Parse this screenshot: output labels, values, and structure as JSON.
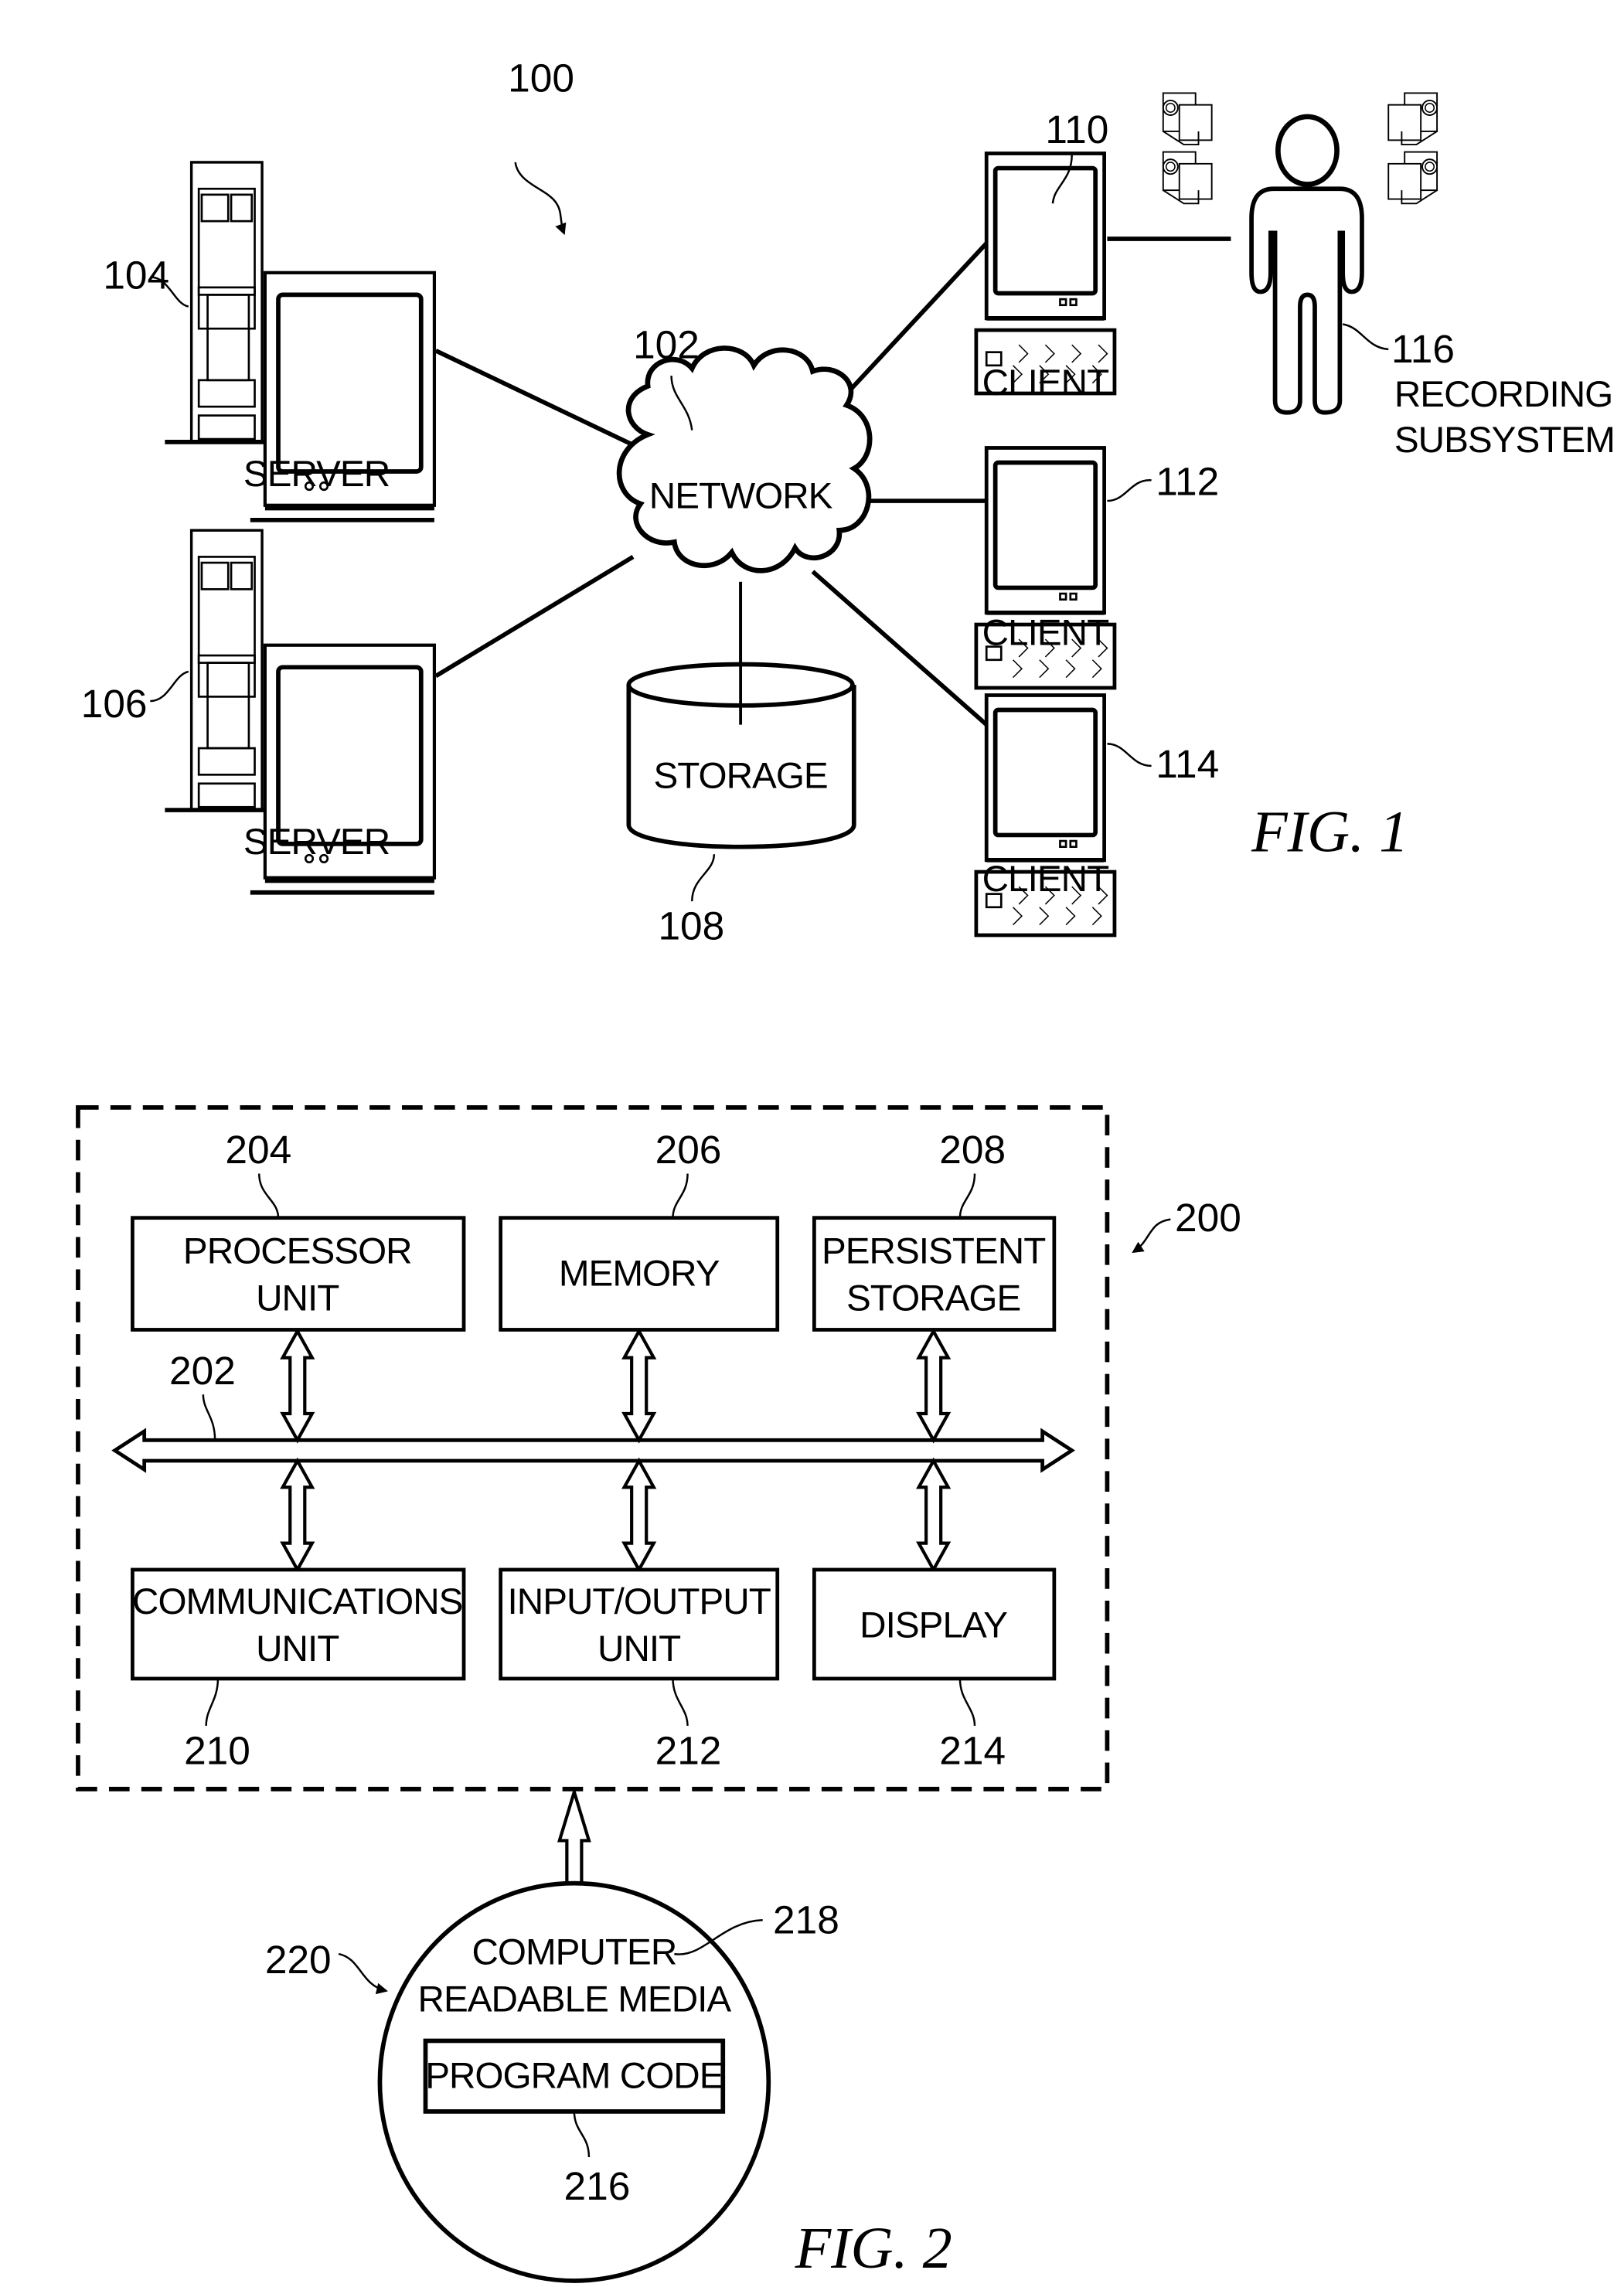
{
  "fig1": {
    "caption": "FIG. 1",
    "system_ref": "100",
    "network": {
      "ref": "102",
      "label": "NETWORK"
    },
    "servers": [
      {
        "ref": "104",
        "label": "SERVER"
      },
      {
        "ref": "106",
        "label": "SERVER"
      }
    ],
    "storage": {
      "ref": "108",
      "label": "STORAGE"
    },
    "clients": [
      {
        "ref": "110",
        "label": "CLIENT"
      },
      {
        "ref": "112",
        "label": "CLIENT"
      },
      {
        "ref": "114",
        "label": "CLIENT"
      }
    ],
    "recording": {
      "ref": "116",
      "label_line1": "RECORDING",
      "label_line2": "SUBSYSTEM"
    }
  },
  "fig2": {
    "caption": "FIG. 2",
    "system_ref": "200",
    "bus_ref": "202",
    "blocks": [
      {
        "ref": "204",
        "line1": "PROCESSOR",
        "line2": "UNIT"
      },
      {
        "ref": "206",
        "line1": "MEMORY",
        "line2": ""
      },
      {
        "ref": "208",
        "line1": "PERSISTENT",
        "line2": "STORAGE"
      },
      {
        "ref": "210",
        "line1": "COMMUNICATIONS",
        "line2": "UNIT"
      },
      {
        "ref": "212",
        "line1": "INPUT/OUTPUT",
        "line2": "UNIT"
      },
      {
        "ref": "214",
        "line1": "DISPLAY",
        "line2": ""
      }
    ],
    "media": {
      "ref": "220",
      "label_ref": "218",
      "line1": "COMPUTER",
      "line2": "READABLE MEDIA"
    },
    "program_code": {
      "ref": "216",
      "label": "PROGRAM CODE"
    }
  }
}
